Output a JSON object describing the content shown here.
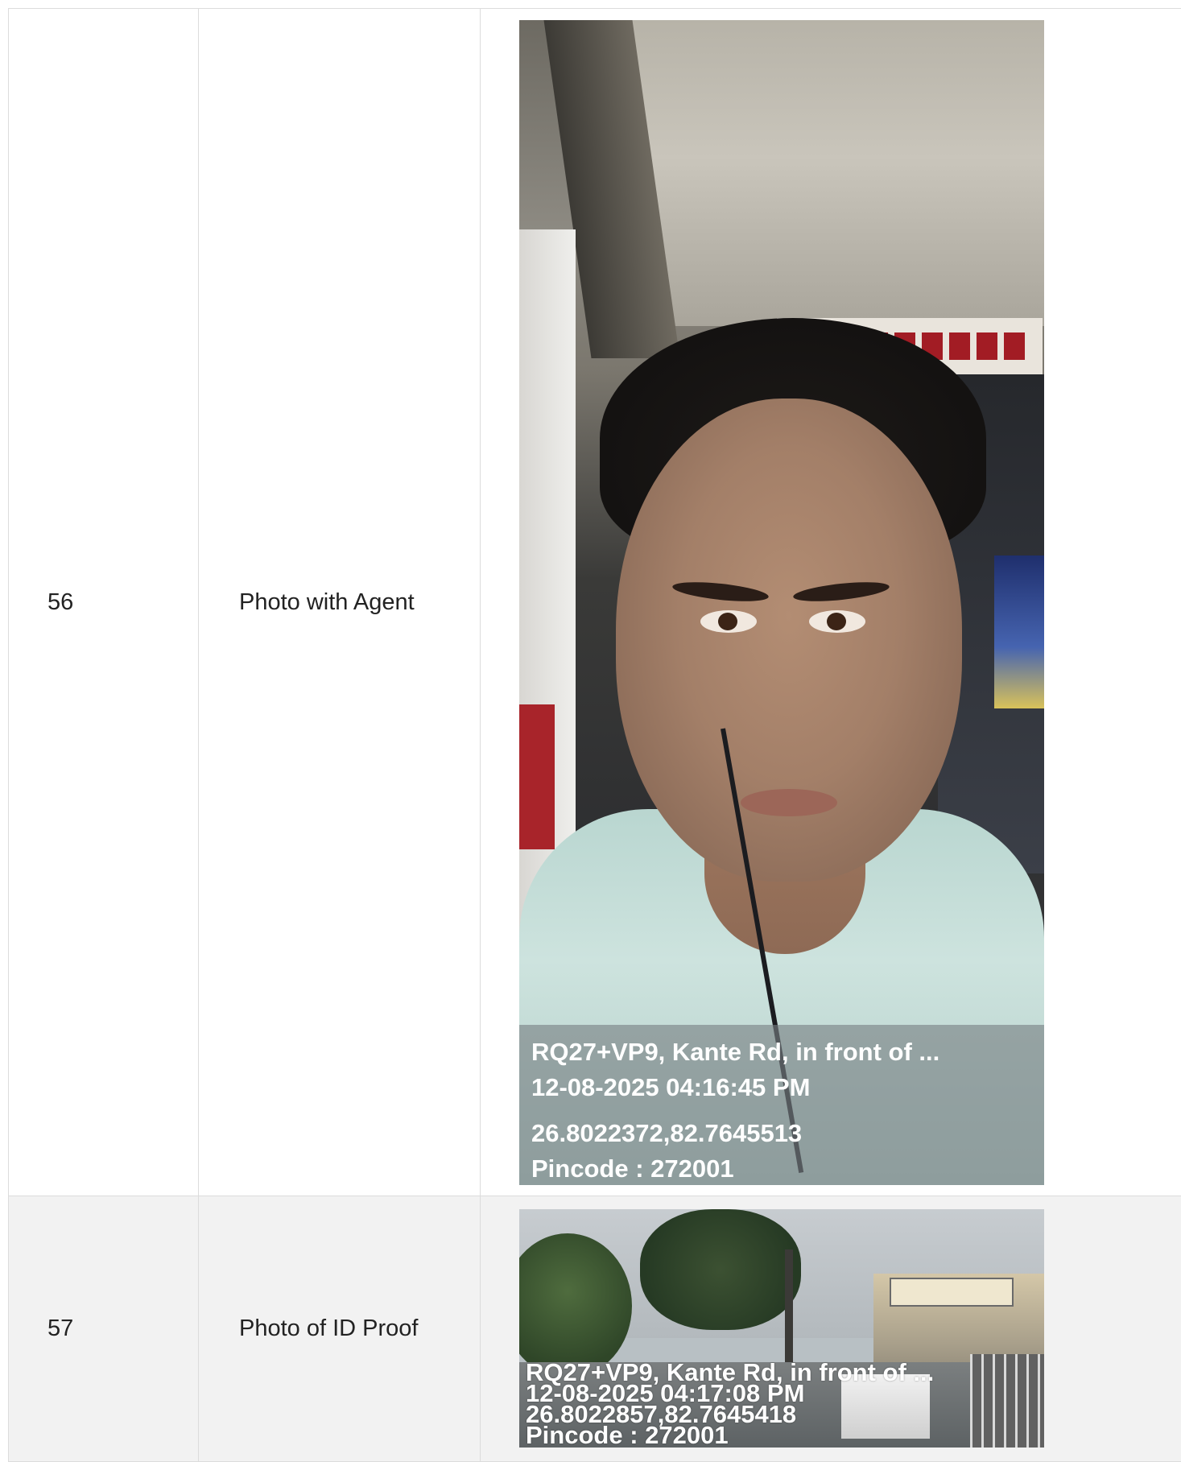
{
  "rows": [
    {
      "number": "56",
      "label": "Photo with Agent",
      "photo": {
        "overlay": {
          "address": "RQ27+VP9, Kante Rd, in front of ...",
          "datetime": "12-08-2025 04:16:45 PM",
          "coordinates": "26.8022372,82.7645513",
          "pincode": "Pincode : 272001"
        }
      }
    },
    {
      "number": "57",
      "label": "Photo of ID Proof",
      "photo": {
        "overlay": {
          "address": "RQ27+VP9, Kante Rd, in front of ...",
          "datetime": "12-08-2025 04:17:08 PM",
          "coordinates": "26.8022857,82.7645418",
          "pincode": "Pincode : 272001"
        }
      }
    }
  ]
}
